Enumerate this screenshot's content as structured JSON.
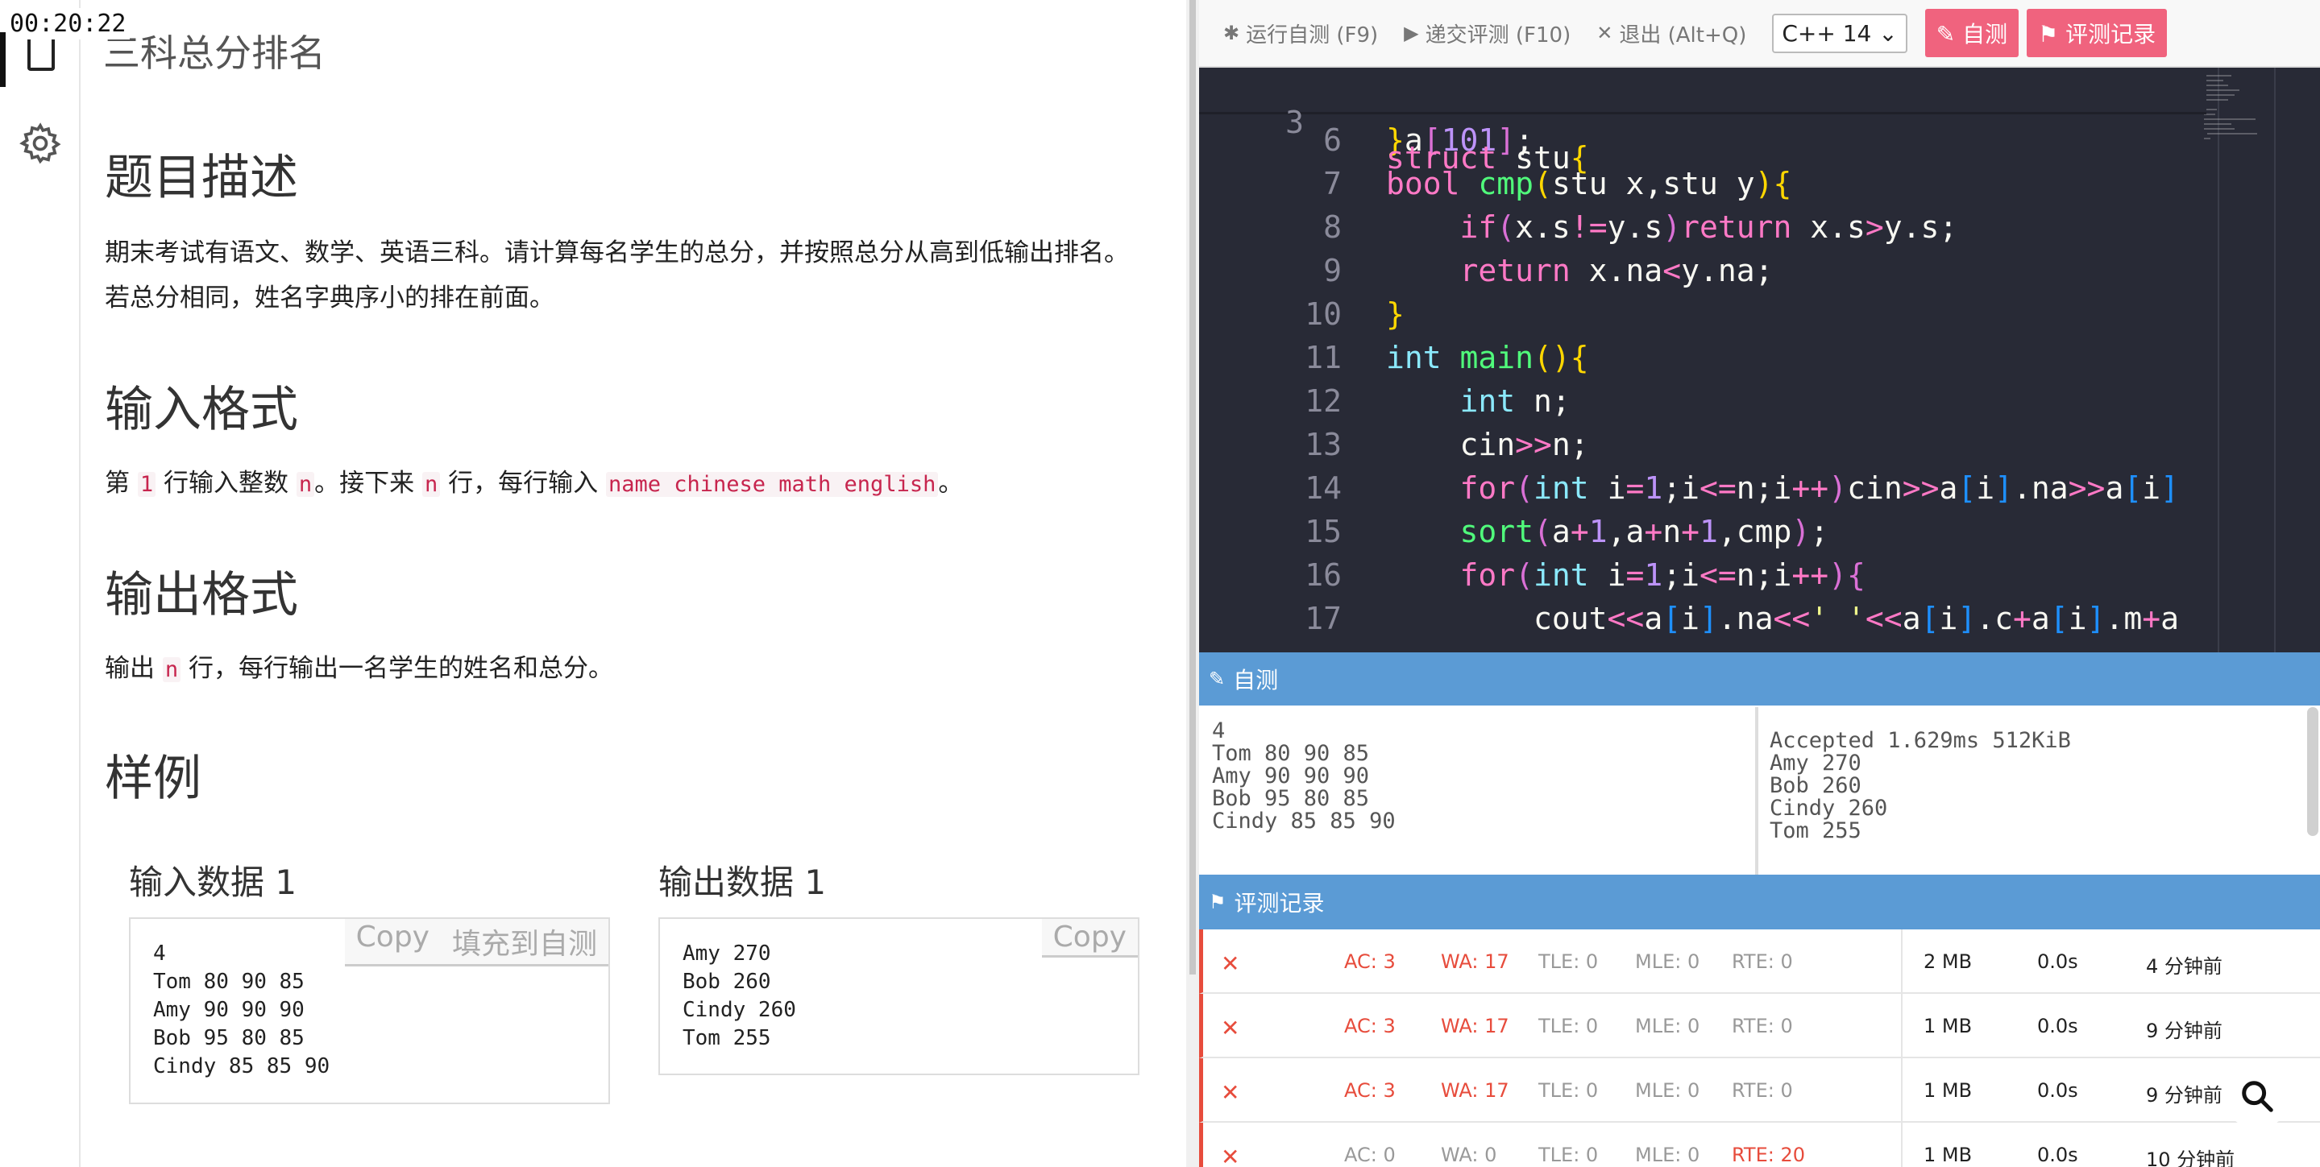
{
  "timer": "00:20:22",
  "problem": {
    "title": "三科总分排名",
    "desc_heading": "题目描述",
    "desc_line1": "期末考试有语文、数学、英语三科。请计算每名学生的总分，并按照总分从高到低输出排名。",
    "desc_line2": "若总分相同，姓名字典序小的排在前面。",
    "input_heading": "输入格式",
    "input_parts": [
      "第",
      "1",
      "行输入整数",
      "n",
      "。接下来",
      "n",
      "行，每行输入",
      "name chinese math english",
      "。"
    ],
    "output_heading": "输出格式",
    "output_parts": [
      "输出",
      "n",
      "行，每行输出一名学生的姓名和总分。"
    ],
    "sample_heading": "样例",
    "sample_in_label": "输入数据 1",
    "sample_out_label": "输出数据 1",
    "sample_in": "4\nTom 80 90 85\nAmy 90 90 90\nBob 95 80 85\nCindy 85 85 90",
    "sample_out": "Amy 270\nBob 260\nCindy 260\nTom 255",
    "copy_label": "Copy",
    "fill_label": "填充到自测"
  },
  "toolbar": {
    "run_label": "运行自测 (F9)",
    "submit_label": "递交评测 (F10)",
    "exit_label": "退出 (Alt+Q)",
    "lang": "C++ 14",
    "selftest_label": "自测",
    "records_label": "评测记录"
  },
  "editor": {
    "sticky_line": {
      "num": "3",
      "code": "struct stu{"
    },
    "lines": [
      {
        "num": "6",
        "code": "}a[101];"
      },
      {
        "num": "7",
        "code": "bool cmp(stu x,stu y){"
      },
      {
        "num": "8",
        "code": "    if(x.s!=y.s)return x.s>y.s;"
      },
      {
        "num": "9",
        "code": "    return x.na<y.na;"
      },
      {
        "num": "10",
        "code": "}"
      },
      {
        "num": "11",
        "code": "int main(){"
      },
      {
        "num": "12",
        "code": "    int n;"
      },
      {
        "num": "13",
        "code": "    cin>>n;"
      },
      {
        "num": "14",
        "code": "    for(int i=1;i<=n;i++)cin>>a[i].na>>a[i]"
      },
      {
        "num": "15",
        "code": "    sort(a+1,a+n+1,cmp);"
      },
      {
        "num": "16",
        "code": "    for(int i=1;i<=n;i++){"
      },
      {
        "num": "17",
        "code": "        cout<<a[i].na<<' '<<a[i].c+a[i].m+a"
      }
    ]
  },
  "selftest": {
    "heading": "自测",
    "input": "4\nTom 80 90 85\nAmy 90 90 90\nBob 95 80 85\nCindy 85 85 90",
    "output": "Accepted 1.629ms 512KiB\nAmy 270\nBob 260\nCindy 260\nTom 255"
  },
  "records": {
    "heading": "评测记录",
    "rows": [
      {
        "ac": "AC: 3",
        "wa": "WA: 17",
        "tle": "TLE: 0",
        "mle": "MLE: 0",
        "rte": "RTE: 0",
        "mem": "2 MB",
        "time": "0.0s",
        "ago": "4 分钟前"
      },
      {
        "ac": "AC: 3",
        "wa": "WA: 17",
        "tle": "TLE: 0",
        "mle": "MLE: 0",
        "rte": "RTE: 0",
        "mem": "1 MB",
        "time": "0.0s",
        "ago": "9 分钟前"
      },
      {
        "ac": "AC: 3",
        "wa": "WA: 17",
        "tle": "TLE: 0",
        "mle": "MLE: 0",
        "rte": "RTE: 0",
        "mem": "1 MB",
        "time": "0.0s",
        "ago": "9 分钟前"
      },
      {
        "ac": "AC: 0",
        "wa": "WA: 0",
        "tle": "TLE: 0",
        "mle": "MLE: 0",
        "rte": "RTE: 20",
        "mem": "1 MB",
        "time": "0.0s",
        "ago": "10 分钟前"
      }
    ]
  },
  "colors": {
    "accent": "#5b9bd5",
    "pink": "#f0637e",
    "error": "#e74c3c",
    "editor_bg": "#282a36"
  }
}
